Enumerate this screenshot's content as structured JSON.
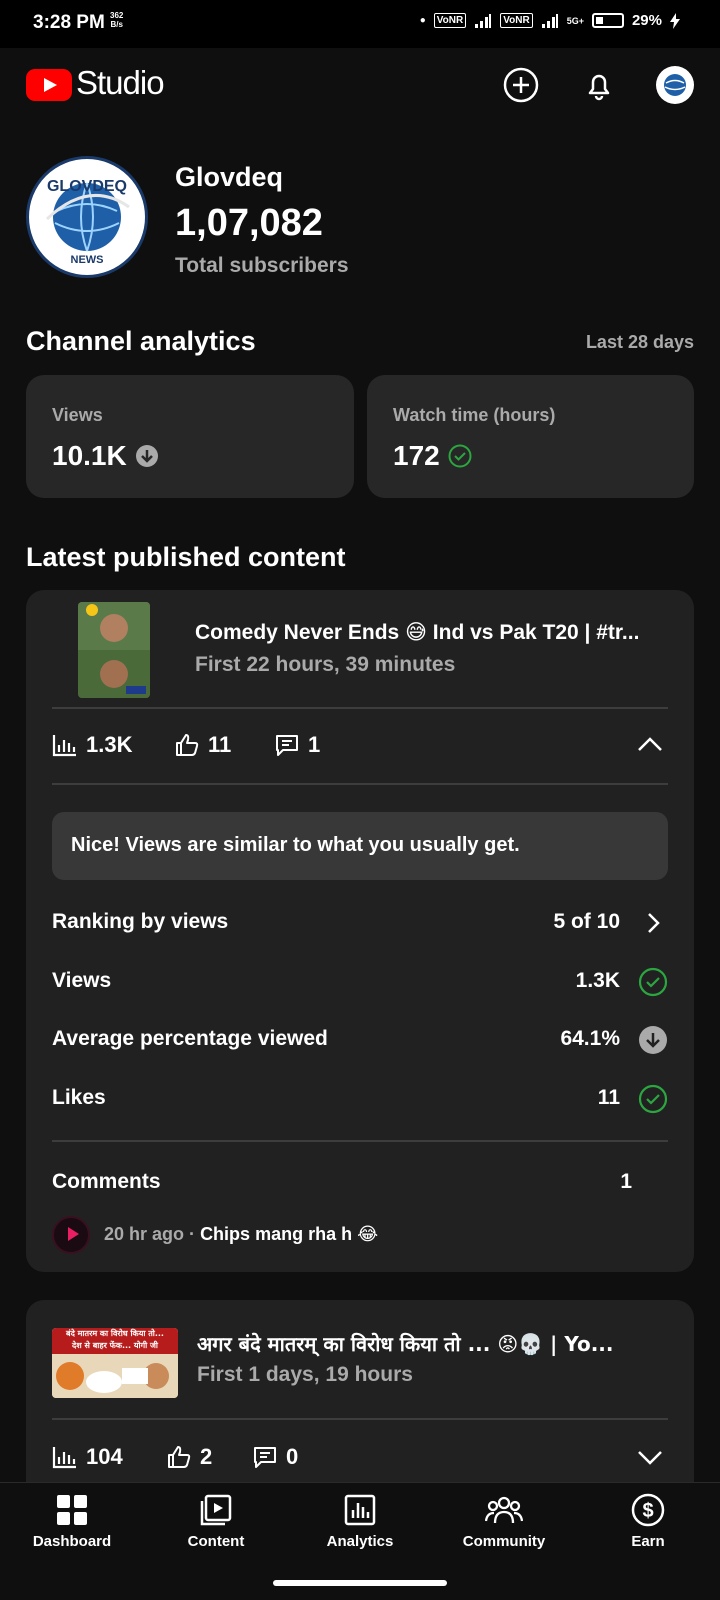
{
  "status_bar": {
    "time": "3:28 PM",
    "net_speed_value": "362",
    "net_speed_unit": "B/s",
    "volte_1": "VoNR",
    "volte_2": "VoNR",
    "network_type": "5G+",
    "battery": "29%"
  },
  "header": {
    "logo_text": "Studio",
    "icons": [
      "create-icon",
      "notifications-icon",
      "account-avatar"
    ]
  },
  "channel": {
    "name": "Glovdeq",
    "subscribers": "1,07,082",
    "subscribers_label": "Total subscribers",
    "avatar_text_top": "GLOVDEQ",
    "avatar_text_bottom": "NEWS"
  },
  "analytics": {
    "title": "Channel analytics",
    "range": "Last 28 days",
    "cards": [
      {
        "label": "Views",
        "value": "10.1K",
        "status": "down"
      },
      {
        "label": "Watch time (hours)",
        "value": "172",
        "status": "ok"
      }
    ]
  },
  "latest": {
    "title": "Latest published content",
    "videos": [
      {
        "title": "Comedy Never Ends 😅 Ind vs Pak T20 | #tr...",
        "subtitle": "First 22 hours, 39 minutes",
        "views": "1.3K",
        "likes": "11",
        "comments": "1",
        "insight": "Nice! Views are similar to what you usually get.",
        "rows": [
          {
            "label": "Ranking by views",
            "value": "5 of 10",
            "icon": "chevron-right"
          },
          {
            "label": "Views",
            "value": "1.3K",
            "icon": "check"
          },
          {
            "label": "Average percentage viewed",
            "value": "64.1%",
            "icon": "down"
          },
          {
            "label": "Likes",
            "value": "11",
            "icon": "check"
          }
        ],
        "comments_label": "Comments",
        "comments_count": "1",
        "latest_comment": {
          "time": "20 hr ago",
          "separator": "·",
          "text": "Chips mang rha h 😂"
        }
      },
      {
        "title": "अगर बंदे मातरम् का विरोध किया तो ... 😡💀 | Yo...",
        "subtitle": "First 1 days, 19 hours",
        "views": "104",
        "likes": "2",
        "comments": "0",
        "thumb_text_1": "बंदे मातरम का विरोध किया तो...",
        "thumb_text_2": "देश से बाहर फेंक... योगी जी"
      }
    ]
  },
  "nav": {
    "items": [
      {
        "label": "Dashboard",
        "icon": "dashboard-icon"
      },
      {
        "label": "Content",
        "icon": "content-icon"
      },
      {
        "label": "Analytics",
        "icon": "analytics-icon"
      },
      {
        "label": "Community",
        "icon": "community-icon"
      },
      {
        "label": "Earn",
        "icon": "earn-icon"
      }
    ]
  },
  "colors": {
    "background": "#0f0f0f",
    "card": "#212121",
    "accent_red": "#ff0000",
    "success_green": "#2ba640",
    "muted_text": "#aaaaaa"
  }
}
